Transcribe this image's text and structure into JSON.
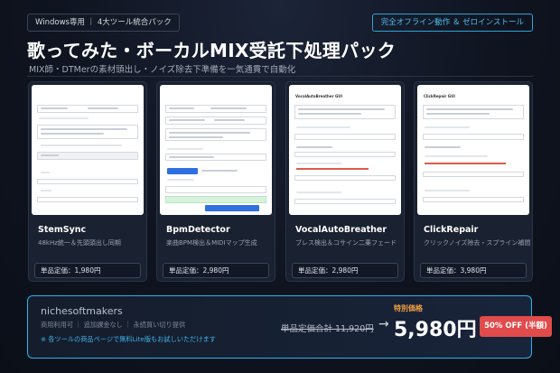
{
  "badge_left": "Windows専用 ｜ 4大ツール統合パック",
  "badge_right": "完全オフライン動作 ＆ ゼロインストール",
  "title": "歌ってみた・ボーカルMIX受託下処理パック",
  "subtitle": "MIX師・DTMerの素材頭出し・ノイズ除去下準備を一気通貫で自動化",
  "products": [
    {
      "name": "StemSync",
      "desc": "48kHz統一＆先頭頭出し同期",
      "price": "単品定価：1,980円",
      "shot_title": ""
    },
    {
      "name": "BpmDetector",
      "desc": "楽曲BPM検出＆MIDIマップ生成",
      "price": "単品定価：2,980円",
      "shot_title": ""
    },
    {
      "name": "VocalAutoBreather",
      "desc": "ブレス検出＆コサイン二乗フェード",
      "price": "単品定価：2,980円",
      "shot_title": "VocalAutoBreather GUI"
    },
    {
      "name": "ClickRepair",
      "desc": "クリックノイズ除去・スプライン補間",
      "price": "単品定価：3,980円",
      "shot_title": "ClickRepair GUI"
    }
  ],
  "bundle": {
    "brand": "nichesoftmakers",
    "terms": "商用利用可 ｜ 追加課金なし ｜ 永続買い切り提供",
    "note": "※ 各ツールの商品ページで無料Lite版もお試しいただけます",
    "special_label": "特別価格",
    "original_total": "単品定価合計 11,920円",
    "arrow": "→",
    "price": "5,980円",
    "discount": "50% OFF (半額)"
  },
  "colors": {
    "accent": "#28b4ea",
    "special": "#f4a340",
    "discount": "#e14b4b",
    "background": "#0f1420"
  }
}
